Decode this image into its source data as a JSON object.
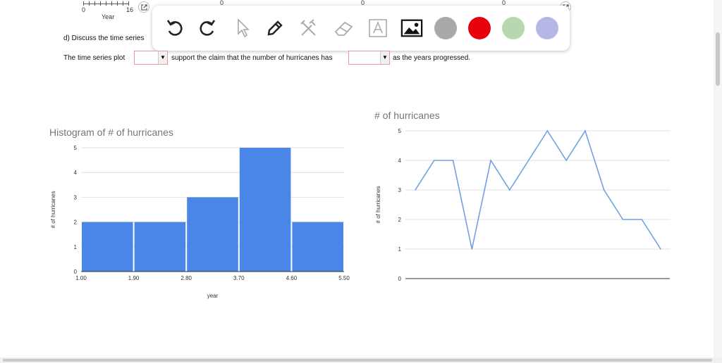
{
  "top_strip": {
    "axis_ticks": [
      "0",
      "16"
    ],
    "axis_zero_labels": [
      "0",
      "0",
      "0"
    ],
    "axis_label": "Year"
  },
  "toolbar": {
    "tools": [
      {
        "name": "undo-icon",
        "label": "Undo"
      },
      {
        "name": "redo-icon",
        "label": "Redo"
      },
      {
        "name": "pointer-icon",
        "label": "Select"
      },
      {
        "name": "pen-icon",
        "label": "Pen"
      },
      {
        "name": "tools-icon",
        "label": "Tools"
      },
      {
        "name": "eraser-icon",
        "label": "Eraser"
      },
      {
        "name": "text-icon",
        "label": "Text"
      },
      {
        "name": "image-icon",
        "label": "Image"
      }
    ],
    "colors": [
      "#a9a9a9",
      "#e8000b",
      "#b7d7b1",
      "#b5b8e6"
    ]
  },
  "question": {
    "prompt": "d) Discuss the time series",
    "sentence_part1": "The time series plot",
    "sentence_part2": "support the claim that the number of hurricanes has",
    "sentence_part3": "as the years progressed.",
    "select1_value": "",
    "select2_value": "",
    "dropdown_glyph": "▼"
  },
  "chart_data": [
    {
      "type": "bar",
      "title": "Histogram of # of hurricanes",
      "xlabel": "year",
      "ylabel": "# of hurricanes",
      "bin_edges": [
        1.0,
        1.9,
        2.8,
        3.7,
        4.6,
        5.5
      ],
      "tick_labels": [
        "1.00",
        "1.90",
        "2.80",
        "3.70",
        "4.60",
        "5.50"
      ],
      "values": [
        2,
        2,
        3,
        5,
        2
      ],
      "ylim": [
        0,
        5
      ],
      "yticks": [
        0,
        1,
        2,
        3,
        4,
        5
      ],
      "color": "#4a86e8",
      "grid": true
    },
    {
      "type": "line",
      "title": "# of hurricanes",
      "xlabel": "",
      "ylabel": "# of hurricanes",
      "values": [
        3,
        4,
        4,
        1,
        4,
        3,
        4,
        5,
        4,
        5,
        3,
        2,
        2,
        1
      ],
      "ylim": [
        0,
        5
      ],
      "yticks": [
        0,
        1,
        2,
        3,
        4,
        5
      ],
      "color": "#6fa1e4",
      "grid": true
    }
  ]
}
